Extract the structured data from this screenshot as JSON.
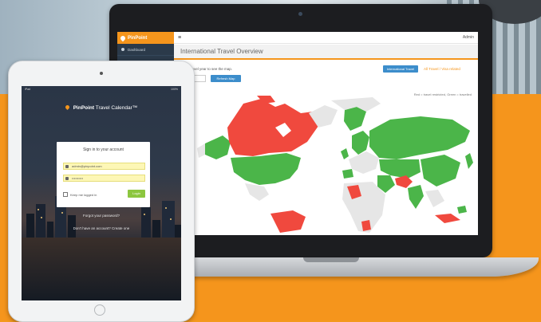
{
  "laptop": {
    "brand": "PinPoint",
    "sidebar_item": "Dashboard",
    "topbar_menu_glyph": "≡",
    "topbar_user": "Admin",
    "page_title": "International Travel Overview",
    "description": "Select travel year to see the map.",
    "year_value": "2015",
    "year_button": "Refresh Map",
    "intl_button": "International Travel",
    "visa_link": "All Travel / Visa related",
    "legend_text": "Red = travel restricted, Green = travelled",
    "colors": {
      "red": "#f0493e",
      "green": "#4bb549",
      "grey": "#e6e6e6",
      "accent": "#f5951c"
    }
  },
  "ipad": {
    "status_left": "iPad",
    "status_right": "100%",
    "app_brand": "PinPoint",
    "app_title": "Travel Calendar™",
    "login_header": "Sign in to your account",
    "username_value": "admin@pinpoint.com",
    "password_value": "••••••••••",
    "remember_label": "Keep me logged in",
    "signin_label": "Login",
    "forgot_text": "Forgot your password?",
    "register_text": "Don't have an account? Create one"
  }
}
